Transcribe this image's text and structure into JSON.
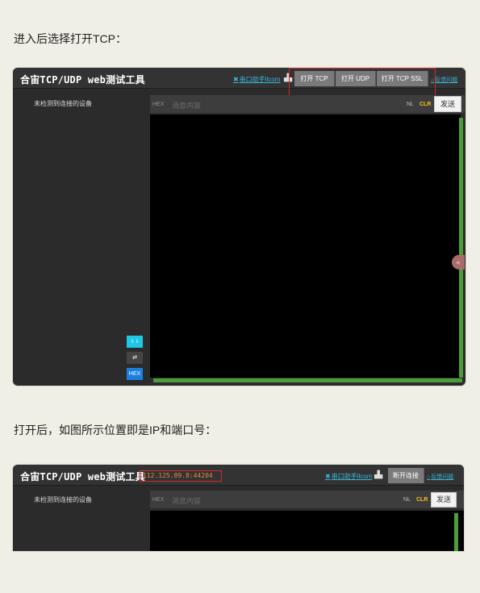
{
  "intro_text": "进入后选择打开TCP：",
  "after_text": "打开后，如图所示位置即是IP和端口号：",
  "app": {
    "title": "合宙TCP/UDP web测试工具",
    "serial_link": "串口助手llcom",
    "buttons": {
      "open_tcp": "打开 TCP",
      "open_udp": "打开 UDP",
      "open_tcp_ssl": "打开 TCP SSL"
    },
    "feedback": "反馈问题",
    "sidebar_text": "未检测到连接的设备",
    "hex_tag": "HEX",
    "input_placeholder": "消息内容",
    "nl_label": "NL",
    "clr_label": "CLR",
    "send_label": "发送",
    "side_buttons": {
      "hex_label": "HEX"
    }
  },
  "app2": {
    "address": "112.125.89.8:44204",
    "disconnect_label": "断开连接"
  },
  "colors": {
    "page_bg": "#efefe6",
    "highlight": "#d42a2a",
    "scrollbar": "#4c9c3c",
    "clr": "#f1c21b",
    "link": "#37b6d6"
  }
}
